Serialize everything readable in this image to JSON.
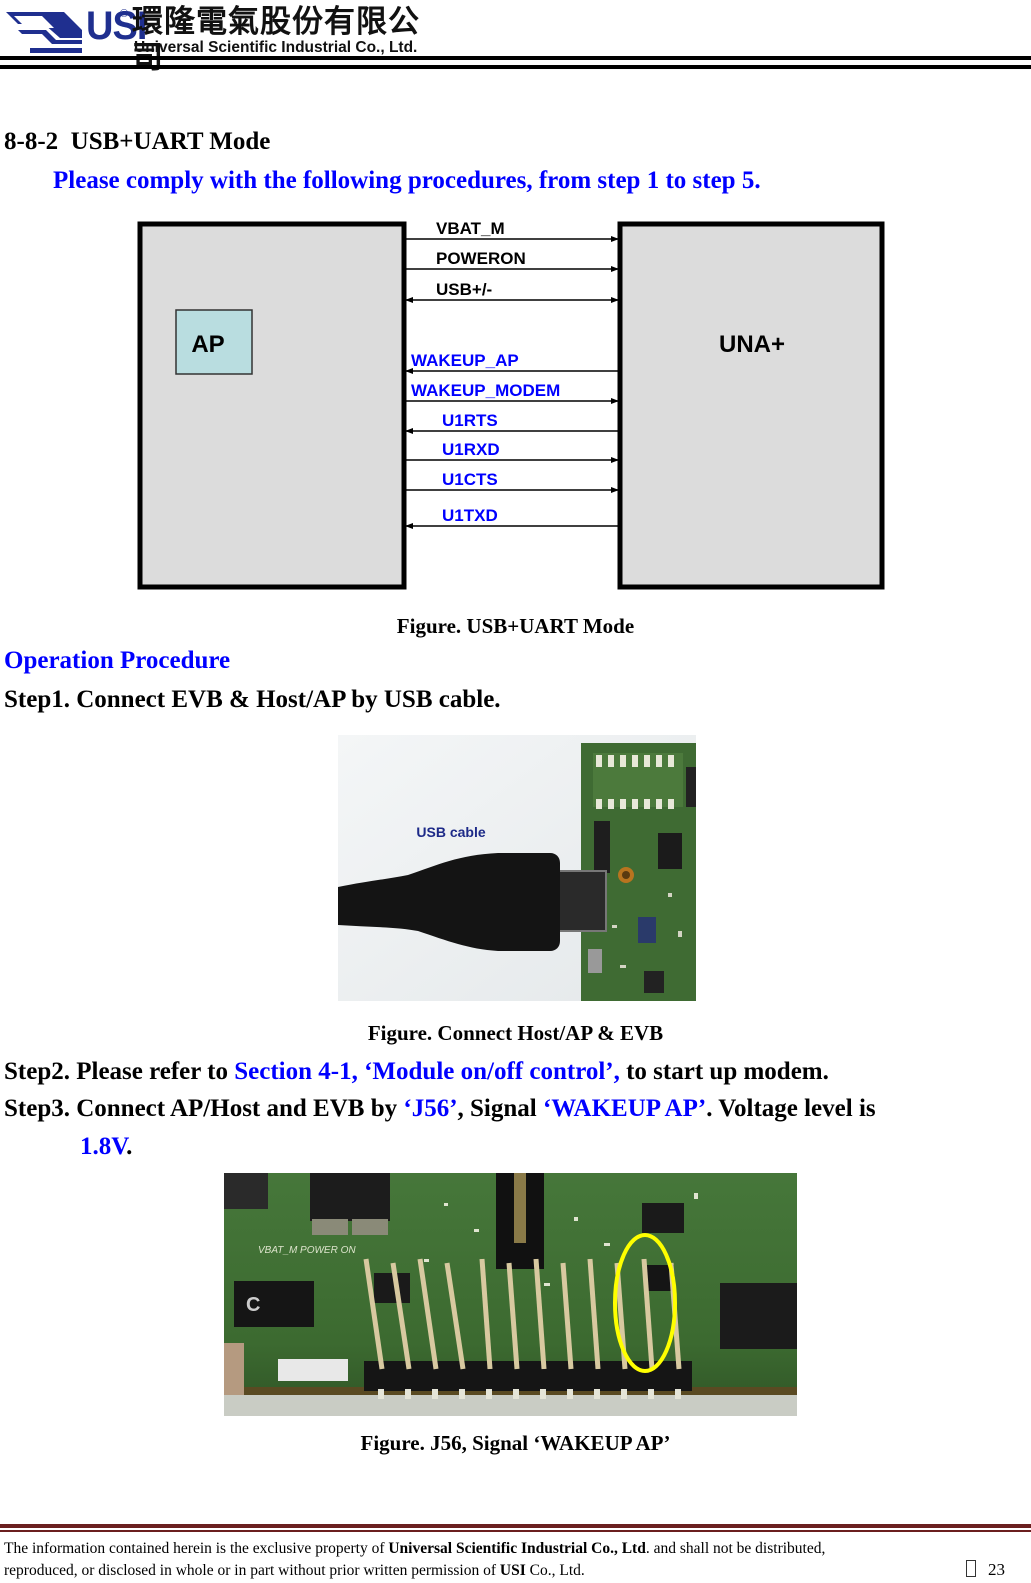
{
  "header": {
    "logo_brand": "USI",
    "logo_registered": "®",
    "logo_chinese": "環隆電氣股份有限公司",
    "logo_english": "Universal Scientific Industrial Co., Ltd."
  },
  "section": {
    "number": "8-8-2",
    "title": "USB+UART Mode",
    "intro": "Please comply with the following procedures, from step 1 to step 5."
  },
  "diagram": {
    "left_block_label": "AP",
    "right_block_label": "UNA+",
    "signals": [
      {
        "name": "VBAT_M",
        "direction": "to-right",
        "color": "#000000"
      },
      {
        "name": "POWERON",
        "direction": "to-right",
        "color": "#000000"
      },
      {
        "name": "USB+/-",
        "direction": "both",
        "color": "#000000"
      },
      {
        "name": "WAKEUP_AP",
        "direction": "to-left",
        "color": "#0000ff"
      },
      {
        "name": "WAKEUP_MODEM",
        "direction": "to-right",
        "color": "#0000ff"
      },
      {
        "name": "U1RTS",
        "direction": "to-left",
        "color": "#0000ff"
      },
      {
        "name": "U1RXD",
        "direction": "to-right",
        "color": "#0000ff"
      },
      {
        "name": "U1CTS",
        "direction": "to-right",
        "color": "#0000ff"
      },
      {
        "name": "U1TXD",
        "direction": "to-left",
        "color": "#0000ff"
      }
    ],
    "caption": "Figure. USB+UART Mode"
  },
  "procedure": {
    "title": "Operation Procedure",
    "step1": "Step1. Connect EVB & Host/AP by USB cable.",
    "photo1_label": "USB cable",
    "photo1_caption": "Figure. Connect Host/AP & EVB",
    "step2": {
      "prefix": "Step2. Please refer to ",
      "link": "Section 4-1, ‘Module on/off control’,",
      "suffix": " to start up modem."
    },
    "step3": {
      "prefix": "Step3. Connect AP/Host and EVB by ",
      "connector": "‘J56’",
      "middle": ", Signal ",
      "signal": "‘WAKEUP AP’",
      "suffix": ". Voltage level is",
      "voltage": "1.8V",
      "end": "."
    },
    "photo2_silkscreen": "VBAT_M POWER ON",
    "photo2_caption": "Figure. J56, Signal ‘WAKEUP AP’"
  },
  "footer": {
    "line1_prefix": "The information contained herein is the exclusive property of ",
    "line1_company": "Universal Scientific Industrial Co., Ltd",
    "line1_suffix": ". and shall not be distributed,",
    "line2_prefix": "reproduced, or disclosed in whole or in part without prior written permission of ",
    "line2_brand": "USI",
    "line2_suffix": " Co., Ltd.",
    "page_number": "23"
  },
  "colors": {
    "brand_blue": "#1f2f8f",
    "link_blue": "#0000ff",
    "footer_rule": "#6b1f1f",
    "block_fill": "#dcdcdc",
    "ap_fill": "#b9dde0"
  }
}
